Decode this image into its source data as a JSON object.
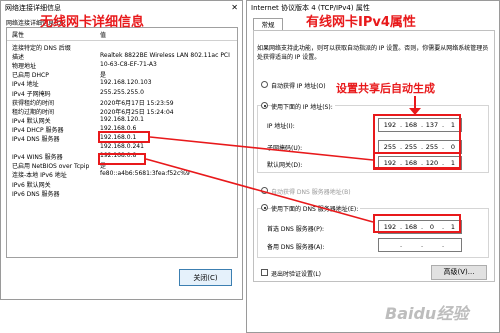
{
  "left_dialog": {
    "title": "网络连接详细信息",
    "caption": "网络连接详细信息(D):",
    "columns": [
      "属性",
      "值"
    ],
    "rows": [
      {
        "prop": "连接特定的 DNS 后缀",
        "val": ""
      },
      {
        "prop": "描述",
        "val": "Realtek 8822BE Wireless LAN 802.11ac PCI"
      },
      {
        "prop": "物理地址",
        "val": "10-63-C8-EF-71-A3"
      },
      {
        "prop": "已启用 DHCP",
        "val": "是"
      },
      {
        "prop": "IPv4 地址",
        "val": "192.168.120.103"
      },
      {
        "prop": "IPv4 子网掩码",
        "val": "255.255.255.0"
      },
      {
        "prop": "获得租约的时间",
        "val": "2020年6月17日 15:23:59"
      },
      {
        "prop": "租约过期的时间",
        "val": "2020年6月25日 15:24:04"
      },
      {
        "prop": "IPv4 默认网关",
        "val": "192.168.120.1"
      },
      {
        "prop": "IPv4 DHCP 服务器",
        "val": "192.168.0.6"
      },
      {
        "prop": "IPv4 DNS 服务器",
        "val": "192.168.0.1"
      },
      {
        "prop": "",
        "val": "192.168.0.241"
      },
      {
        "prop": "IPv4 WINS 服务器",
        "val": "192.168.0.8"
      },
      {
        "prop": "已启用 NetBIOS over Tcpip",
        "val": "是"
      },
      {
        "prop": "连接-本地 IPv6 地址",
        "val": "fe80::a4b6:5681:3fea:f52c%9"
      },
      {
        "prop": "IPv6 默认网关",
        "val": ""
      },
      {
        "prop": "IPv6 DNS 服务器",
        "val": ""
      }
    ],
    "close_label": "关闭(C)"
  },
  "right_dialog": {
    "title": "Internet 协议版本 4 (TCP/IPv4) 属性",
    "tab_label": "常规",
    "description": "如果网络支持此功能，则可以获取自动指派的 IP 设置。否则，你需要从网络系统管理员处获得适当的 IP 设置。",
    "auto_ip_label": "自动获得 IP 地址(O)",
    "manual_ip_label": "使用下面的 IP 地址(S):",
    "ip_label": "IP 地址(I):",
    "ip_value": [
      "192",
      "168",
      "137",
      "1"
    ],
    "mask_label": "子网掩码(U):",
    "mask_value": [
      "255",
      "255",
      "255",
      "0"
    ],
    "gateway_label": "默认网关(D):",
    "gateway_value": [
      "192",
      "168",
      "120",
      "1"
    ],
    "auto_dns_label": "自动获得 DNS 服务器地址(B)",
    "manual_dns_label": "使用下面的 DNS 服务器地址(E):",
    "pref_dns_label": "首选 DNS 服务器(P):",
    "pref_dns_value": [
      "192",
      "168",
      "0",
      "1"
    ],
    "alt_dns_label": "备用 DNS 服务器(A):",
    "validate_label": "退出时验证设置(L)",
    "advanced_label": "高级(V)..."
  },
  "annotations": {
    "left_heading": "无线网卡详细信息",
    "right_heading": "有线网卡IPv4属性",
    "middle_heading": "设置共享后自动生成",
    "color": "#e8191b"
  },
  "watermark": "Baidu经验"
}
